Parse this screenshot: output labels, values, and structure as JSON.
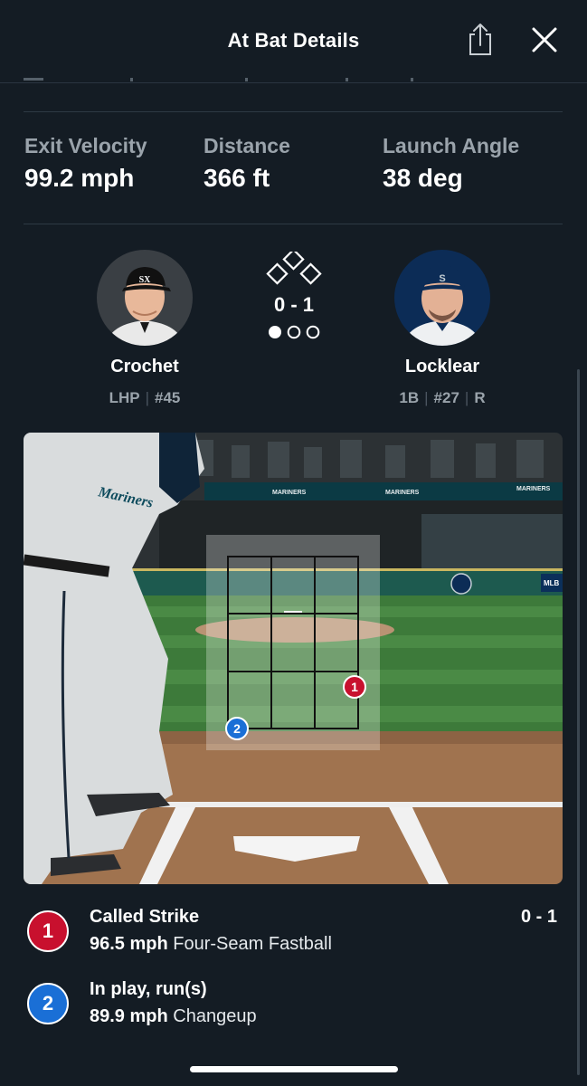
{
  "header": {
    "title": "At Bat Details"
  },
  "stats": [
    {
      "label": "Exit Velocity",
      "value": "99.2 mph"
    },
    {
      "label": "Distance",
      "value": "366 ft"
    },
    {
      "label": "Launch Angle",
      "value": "38 deg"
    }
  ],
  "pitcher": {
    "name": "Crochet",
    "position": "LHP",
    "number": "#45"
  },
  "batter": {
    "name": "Locklear",
    "position": "1B",
    "number": "#27",
    "bats": "R"
  },
  "situation": {
    "count": "0 - 1",
    "outs": 1,
    "outs_max": 3,
    "runners_on": []
  },
  "pitches": [
    {
      "number": "1",
      "result": "Called Strike",
      "speed": "96.5 mph",
      "type": "Four-Seam Fastball",
      "count": "0 - 1",
      "color": "#c8102e"
    },
    {
      "number": "2",
      "result": "In play, run(s)",
      "speed": "89.9 mph",
      "type": "Changeup",
      "count": "",
      "color": "#1a6fd6"
    }
  ],
  "icons": {
    "share": "share-icon",
    "close": "close-icon"
  }
}
